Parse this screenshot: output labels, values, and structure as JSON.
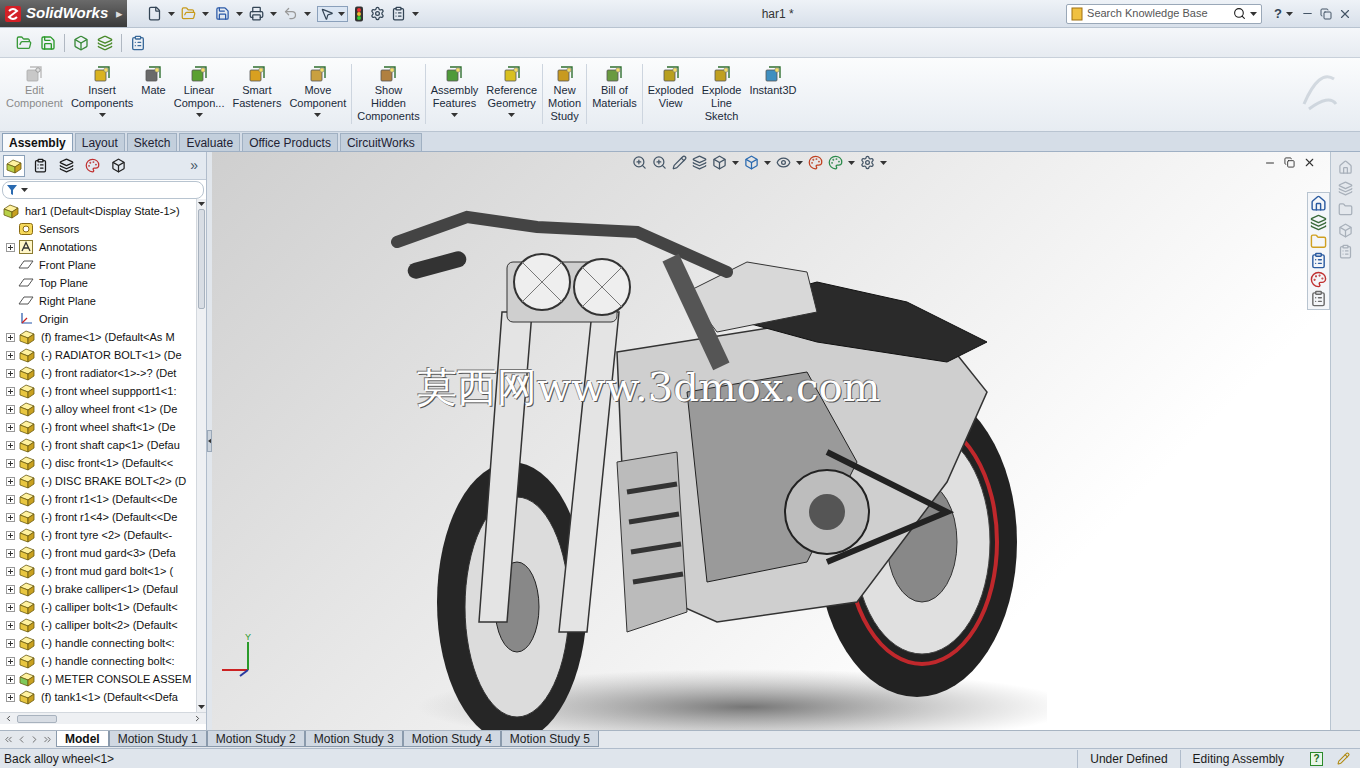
{
  "app": {
    "logo": "SolidWorks",
    "logo_arrow": "▸"
  },
  "window": {
    "title": "har1 *"
  },
  "search": {
    "placeholder": "Search Knowledge Base"
  },
  "help": "?",
  "ribbon": [
    {
      "lines": [
        "Edit",
        "Component"
      ],
      "disabled": true,
      "dropdown": false,
      "separator_after": false
    },
    {
      "lines": [
        "Insert",
        "Components"
      ],
      "disabled": false,
      "dropdown": true,
      "separator_after": false
    },
    {
      "lines": [
        "Mate"
      ],
      "disabled": false,
      "dropdown": false,
      "separator_after": false
    },
    {
      "lines": [
        "Linear",
        "Compon..."
      ],
      "disabled": false,
      "dropdown": true,
      "separator_after": false
    },
    {
      "lines": [
        "Smart",
        "Fasteners"
      ],
      "disabled": false,
      "dropdown": false,
      "separator_after": false
    },
    {
      "lines": [
        "Move",
        "Component"
      ],
      "disabled": false,
      "dropdown": true,
      "separator_after": true
    },
    {
      "lines": [
        "Show",
        "Hidden",
        "Components"
      ],
      "disabled": false,
      "dropdown": false,
      "separator_after": true
    },
    {
      "lines": [
        "Assembly",
        "Features"
      ],
      "disabled": false,
      "dropdown": true,
      "separator_after": false
    },
    {
      "lines": [
        "Reference",
        "Geometry"
      ],
      "disabled": false,
      "dropdown": true,
      "separator_after": true
    },
    {
      "lines": [
        "New",
        "Motion",
        "Study"
      ],
      "disabled": false,
      "dropdown": false,
      "separator_after": true
    },
    {
      "lines": [
        "Bill of",
        "Materials"
      ],
      "disabled": false,
      "dropdown": false,
      "separator_after": true
    },
    {
      "lines": [
        "Exploded",
        "View"
      ],
      "disabled": false,
      "dropdown": false,
      "separator_after": false
    },
    {
      "lines": [
        "Explode",
        "Line",
        "Sketch"
      ],
      "disabled": false,
      "dropdown": false,
      "separator_after": false
    },
    {
      "lines": [
        "Instant3D"
      ],
      "disabled": false,
      "dropdown": false,
      "separator_after": false
    }
  ],
  "tabs": [
    {
      "label": "Assembly",
      "selected": true
    },
    {
      "label": "Layout",
      "selected": false
    },
    {
      "label": "Sketch",
      "selected": false
    },
    {
      "label": "Evaluate",
      "selected": false
    },
    {
      "label": "Office Products",
      "selected": false
    },
    {
      "label": "CircuitWorks",
      "selected": false
    }
  ],
  "panel": {
    "more": "»"
  },
  "tree": [
    {
      "label": "har1  (Default<Display State-1>)",
      "kind": "root",
      "expandable": false,
      "expanded": true
    },
    {
      "label": "Sensors",
      "kind": "sensors",
      "expandable": false,
      "expanded": false
    },
    {
      "label": "Annotations",
      "kind": "annotations",
      "expandable": true,
      "expanded": false
    },
    {
      "label": "Front Plane",
      "kind": "plane",
      "expandable": false,
      "expanded": false
    },
    {
      "label": "Top Plane",
      "kind": "plane",
      "expandable": false,
      "expanded": false
    },
    {
      "label": "Right Plane",
      "kind": "plane",
      "expandable": false,
      "expanded": false
    },
    {
      "label": "Origin",
      "kind": "origin",
      "expandable": false,
      "expanded": false
    },
    {
      "label": "(f) frame<1> (Default<As M",
      "kind": "part",
      "expandable": true,
      "expanded": false
    },
    {
      "label": "(-) RADIATOR BOLT<1> (De",
      "kind": "part",
      "expandable": true,
      "expanded": false
    },
    {
      "label": "(-) front radiator<1>->? (Det",
      "kind": "part",
      "expandable": true,
      "expanded": false
    },
    {
      "label": "(-) front wheel suppport1<1:",
      "kind": "part",
      "expandable": true,
      "expanded": false
    },
    {
      "label": "(-) alloy wheel front <1> (De",
      "kind": "part",
      "expandable": true,
      "expanded": false
    },
    {
      "label": "(-) front wheel shaft<1> (De",
      "kind": "part",
      "expandable": true,
      "expanded": false
    },
    {
      "label": "(-) front shaft cap<1> (Defau",
      "kind": "part",
      "expandable": true,
      "expanded": false
    },
    {
      "label": "(-) disc front<1> (Default<<",
      "kind": "part",
      "expandable": true,
      "expanded": false
    },
    {
      "label": "(-) DISC BRAKE BOLT<2> (D",
      "kind": "part",
      "expandable": true,
      "expanded": false
    },
    {
      "label": "(-) front r1<1> (Default<<De",
      "kind": "part",
      "expandable": true,
      "expanded": false
    },
    {
      "label": "(-) front r1<4> (Default<<De",
      "kind": "part",
      "expandable": true,
      "expanded": false
    },
    {
      "label": "(-) front tyre  <2> (Default<-",
      "kind": "part",
      "expandable": true,
      "expanded": false
    },
    {
      "label": "(-) front mud gard<3> (Defa",
      "kind": "part",
      "expandable": true,
      "expanded": false
    },
    {
      "label": "(-) front mud gard bolt<1> (",
      "kind": "part",
      "expandable": true,
      "expanded": false
    },
    {
      "label": "(-) brake calliper<1> (Defaul",
      "kind": "part",
      "expandable": true,
      "expanded": false
    },
    {
      "label": "(-) calliper bolt<1> (Default<",
      "kind": "part",
      "expandable": true,
      "expanded": false
    },
    {
      "label": "(-) calliper bolt<2> (Default<",
      "kind": "part",
      "expandable": true,
      "expanded": false
    },
    {
      "label": "(-) handle connecting bolt<:",
      "kind": "part",
      "expandable": true,
      "expanded": false
    },
    {
      "label": "(-) handle connecting bolt<:",
      "kind": "part",
      "expandable": true,
      "expanded": false
    },
    {
      "label": "(-) METER CONSOLE ASSEM",
      "kind": "assembly",
      "expandable": true,
      "expanded": false
    },
    {
      "label": "(f) tank1<1> (Default<<Defa",
      "kind": "part",
      "expandable": true,
      "expanded": false
    }
  ],
  "viewport": {
    "watermark": "莫西网www.3dmox.com",
    "axis_label": "Y"
  },
  "bottom_tabs": [
    {
      "label": "Model",
      "selected": true
    },
    {
      "label": "Motion Study 1",
      "selected": false
    },
    {
      "label": "Motion Study 2",
      "selected": false
    },
    {
      "label": "Motion Study 3",
      "selected": false
    },
    {
      "label": "Motion Study 4",
      "selected": false
    },
    {
      "label": "Motion Study 5",
      "selected": false
    }
  ],
  "status_bar": {
    "message": "Back alloy wheel<1>",
    "definition": "Under Defined",
    "mode": "Editing Assembly",
    "help": "?"
  }
}
